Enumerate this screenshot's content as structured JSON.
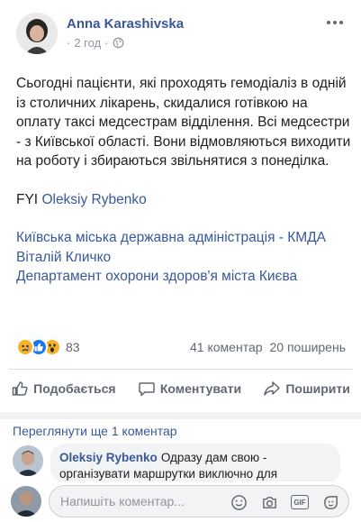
{
  "post": {
    "author": "Anna Karashivska",
    "time": "2 год",
    "dot": "·",
    "paragraphs": [
      "Сьогодні пацієнти, які проходять гемодіаліз в одній із столичних лікарень, скидалися готівкою на оплату таксі медсестрам відділення. Всі медсестри - з Київської області. Вони відмовляються виходити на роботу і збираються звільнятися з понеділка."
    ],
    "fyi_prefix": "FYI",
    "fyi_link": "Oleksiy Rybenko",
    "tags": [
      "Київська міська державна адміністрація - КМДА",
      "Віталій Кличко",
      "Департамент охорони здоров'я міста Києва"
    ]
  },
  "reactions": {
    "count": "83",
    "comments": "41 коментар",
    "shares": "20 поширень"
  },
  "actions": {
    "like": "Подобається",
    "comment": "Коментувати",
    "share": "Поширити"
  },
  "comments": {
    "view_more": "Переглянути ще 1 коментар",
    "items": [
      {
        "author": "Oleksiy Rybenko",
        "text": "Одразу дам свою - організувати маршрутки виключно для"
      }
    ]
  },
  "composer": {
    "placeholder": "Напишіть коментар..."
  },
  "icons": {
    "globe": "globe-icon",
    "more": "more-options-icon",
    "like": "thumbs-up-icon",
    "comment": "speech-bubble-icon",
    "share": "share-arrow-icon",
    "emoji": "smiley-icon",
    "camera": "camera-icon",
    "gif": "gif-icon",
    "sticker": "sticker-icon"
  },
  "colors": {
    "link": "#385898",
    "muted": "#90949c",
    "like_blue": "#1877f2",
    "reaction_yellow": "#f7b125"
  }
}
